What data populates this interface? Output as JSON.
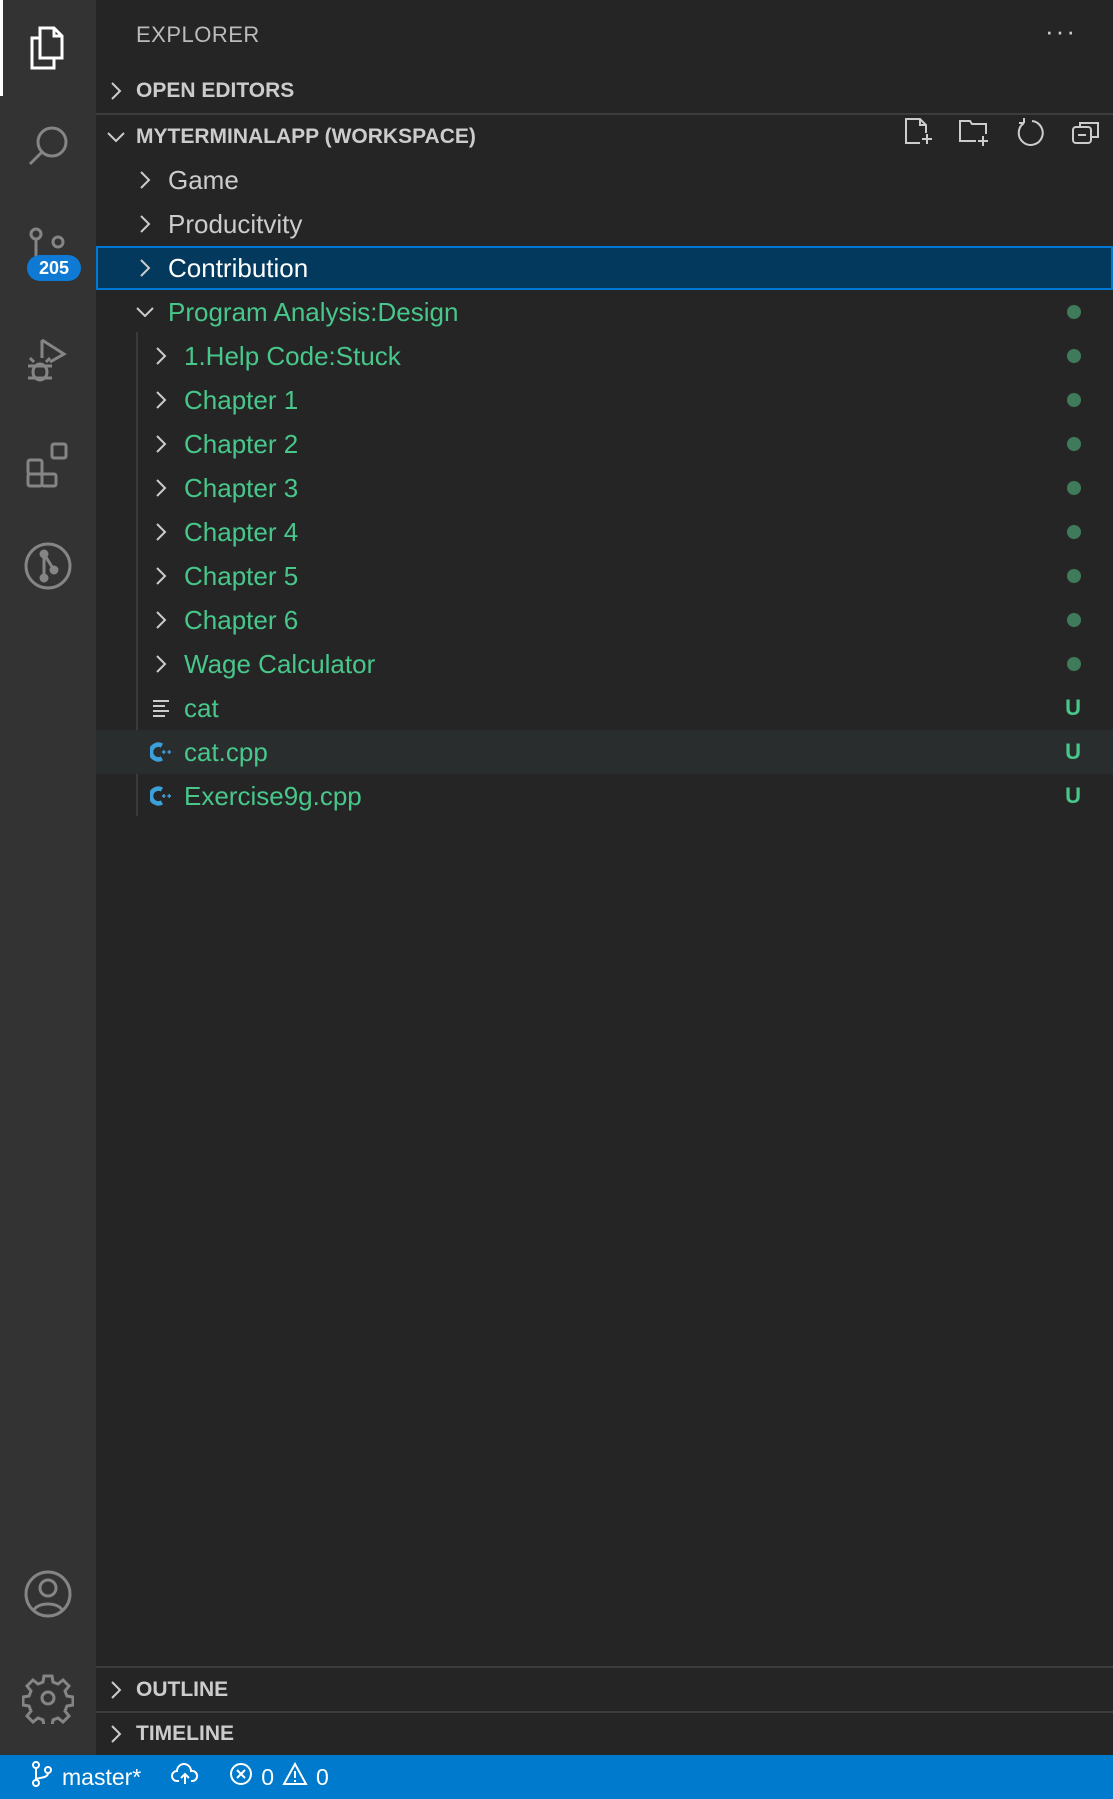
{
  "activity_bar": {
    "items": [
      {
        "name": "explorer",
        "active": true
      },
      {
        "name": "search"
      },
      {
        "name": "source-control",
        "badge": "205"
      },
      {
        "name": "run-and-debug"
      },
      {
        "name": "extensions"
      },
      {
        "name": "git-graph"
      }
    ],
    "bottom": [
      {
        "name": "accounts"
      },
      {
        "name": "manage"
      }
    ]
  },
  "sidebar": {
    "title": "EXPLORER",
    "more_label": "···",
    "open_editors": "OPEN EDITORS",
    "workspace": "MYTERMINALAPP (WORKSPACE)",
    "tree": [
      {
        "label": "Game",
        "type": "folder",
        "level": 0,
        "expanded": false
      },
      {
        "label": "Producitvity",
        "type": "folder",
        "level": 0,
        "expanded": false
      },
      {
        "label": "Contribution",
        "type": "folder",
        "level": 0,
        "expanded": false,
        "selected": true
      },
      {
        "label": "Program Analysis:Design",
        "type": "folder",
        "level": 0,
        "expanded": true,
        "git": "modified"
      },
      {
        "label": "1.Help Code:Stuck",
        "type": "folder",
        "level": 1,
        "git": "modified"
      },
      {
        "label": "Chapter 1",
        "type": "folder",
        "level": 1,
        "git": "modified"
      },
      {
        "label": "Chapter 2",
        "type": "folder",
        "level": 1,
        "git": "modified"
      },
      {
        "label": "Chapter 3",
        "type": "folder",
        "level": 1,
        "git": "modified"
      },
      {
        "label": "Chapter 4",
        "type": "folder",
        "level": 1,
        "git": "modified"
      },
      {
        "label": "Chapter 5",
        "type": "folder",
        "level": 1,
        "git": "modified"
      },
      {
        "label": "Chapter 6",
        "type": "folder",
        "level": 1,
        "git": "modified"
      },
      {
        "label": "Wage Calculator",
        "type": "folder",
        "level": 1,
        "git": "modified"
      },
      {
        "label": "cat",
        "type": "text-file",
        "level": 1,
        "git": "U"
      },
      {
        "label": "cat.cpp",
        "type": "cpp-file",
        "level": 1,
        "git": "U",
        "hover": true
      },
      {
        "label": "Exercise9g.cpp",
        "type": "cpp-file",
        "level": 1,
        "git": "U"
      }
    ],
    "outline": "OUTLINE",
    "timeline": "TIMELINE"
  },
  "status_bar": {
    "branch": "master*",
    "errors": "0",
    "warnings": "0"
  },
  "colors": {
    "accent": "#007acc",
    "selection": "#04395e",
    "git_added": "#48c78a",
    "git_dot": "#3f7b5b"
  }
}
